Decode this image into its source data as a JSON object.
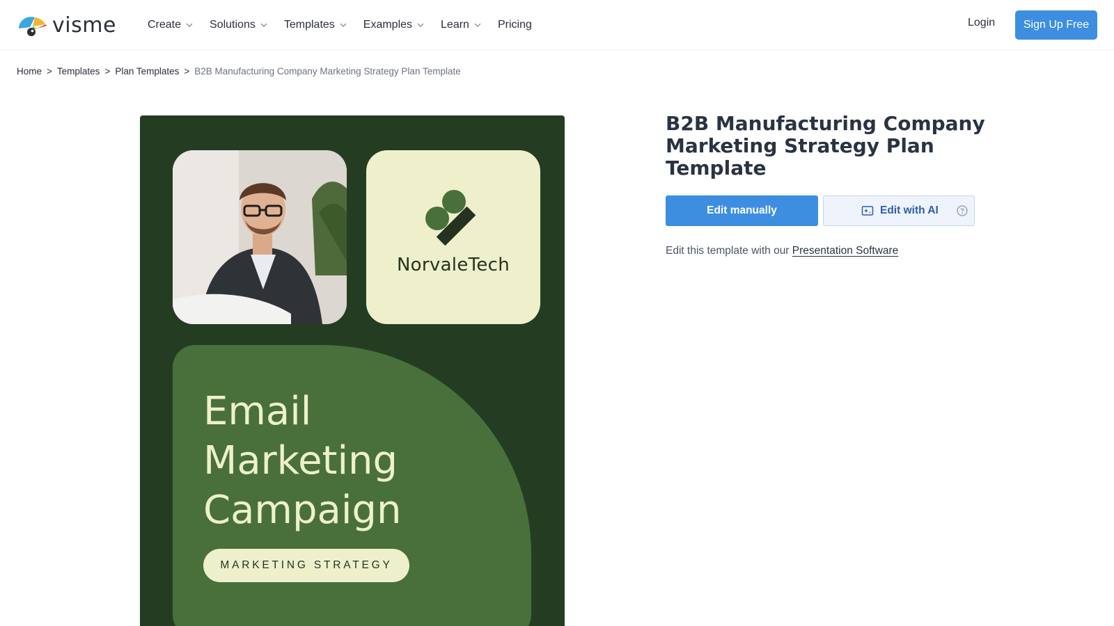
{
  "brand": {
    "name": "visme",
    "accent": "#3d8ee0"
  },
  "nav": {
    "items": [
      {
        "label": "Create",
        "dropdown": true
      },
      {
        "label": "Solutions",
        "dropdown": true
      },
      {
        "label": "Templates",
        "dropdown": true
      },
      {
        "label": "Examples",
        "dropdown": true
      },
      {
        "label": "Learn",
        "dropdown": true
      },
      {
        "label": "Pricing",
        "dropdown": false
      }
    ],
    "login": "Login",
    "signup": "Sign Up Free"
  },
  "breadcrumb": {
    "items": [
      "Home",
      "Templates",
      "Plan Templates"
    ],
    "current": "B2B Manufacturing Company Marketing Strategy Plan Template",
    "separator": ">"
  },
  "preview": {
    "brand_name": "NorvaleTech",
    "headline": "Email Marketing Campaign",
    "pill": "MARKETING STRATEGY",
    "colors": {
      "background": "#243d22",
      "card": "#49703b",
      "cream": "#eef0cc"
    }
  },
  "detail": {
    "title": "B2B Manufacturing Company Marketing Strategy Plan Template",
    "edit_manually": "Edit manually",
    "edit_ai": "Edit with AI",
    "subtext_prefix": "Edit this template with our",
    "subtext_link": "Presentation Software"
  }
}
